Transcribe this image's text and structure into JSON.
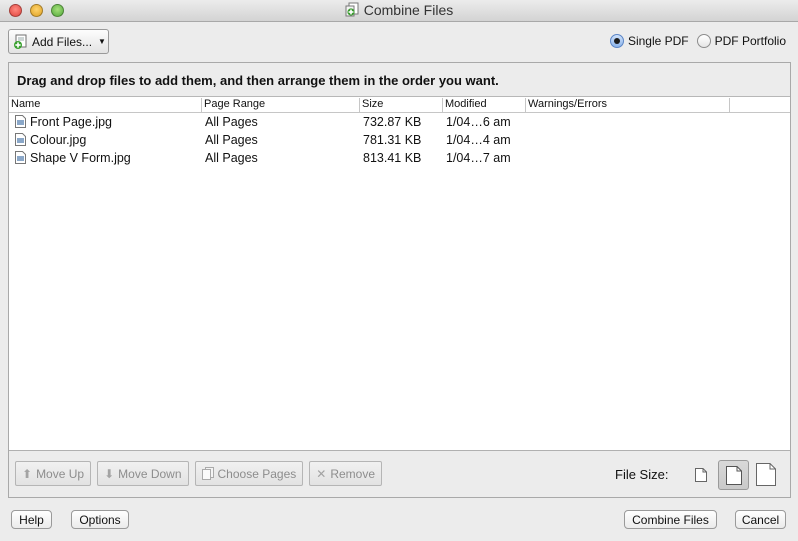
{
  "window": {
    "title": "Combine Files",
    "app_icon": "combine-files-icon"
  },
  "toolbar": {
    "add_files_label": "Add Files...",
    "output_options": [
      {
        "label": "Single PDF",
        "selected": true
      },
      {
        "label": "PDF Portfolio",
        "selected": false
      }
    ]
  },
  "instruction": "Drag and drop files to add them, and then arrange them in the order you want.",
  "table": {
    "columns": [
      "Name",
      "Page Range",
      "Size",
      "Modified",
      "Warnings/Errors"
    ],
    "rows": [
      {
        "name": "Front Page.jpg",
        "page_range": "All Pages",
        "size": "732.87 KB",
        "modified": "1/04…6 am",
        "warnings": ""
      },
      {
        "name": "Colour.jpg",
        "page_range": "All Pages",
        "size": "781.31 KB",
        "modified": "1/04…4 am",
        "warnings": ""
      },
      {
        "name": "Shape V Form.jpg",
        "page_range": "All Pages",
        "size": "813.41 KB",
        "modified": "1/04…7 am",
        "warnings": ""
      }
    ]
  },
  "actions": {
    "move_up": "Move Up",
    "move_down": "Move Down",
    "choose_pages": "Choose Pages",
    "remove": "Remove"
  },
  "file_size": {
    "label": "File Size:",
    "options": [
      "small-file-size-icon",
      "default-file-size-icon",
      "large-file-size-icon"
    ],
    "selected_index": 1
  },
  "footer": {
    "help": "Help",
    "options": "Options",
    "combine": "Combine Files",
    "cancel": "Cancel"
  }
}
